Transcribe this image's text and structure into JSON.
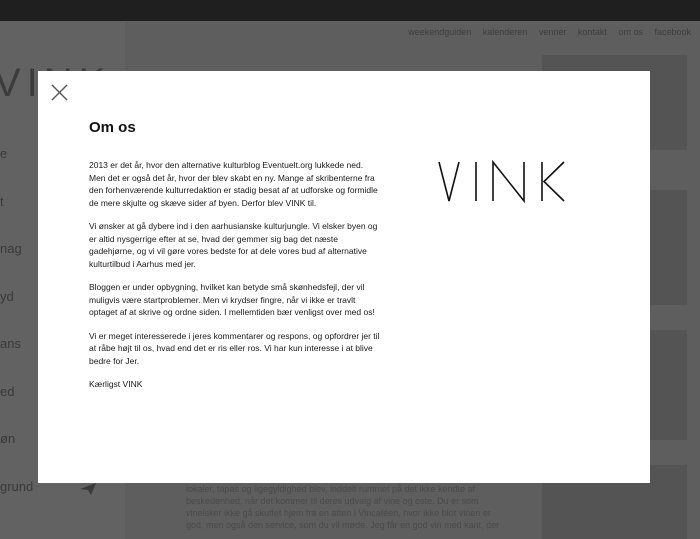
{
  "sidebar": {
    "logo_text": "VINK",
    "items": [
      {
        "label": "e"
      },
      {
        "label": "t"
      },
      {
        "label": "nag"
      },
      {
        "label": "yd"
      },
      {
        "label": "ans"
      },
      {
        "label": "ed"
      },
      {
        "label": "øn"
      },
      {
        "label": "grund"
      }
    ]
  },
  "nav": {
    "links": [
      "weekendguiden",
      "kalenderen",
      "venner",
      "kontakt",
      "om os",
      "facebook"
    ]
  },
  "right_col": {
    "captions": [
      "",
      "",
      "",
      ""
    ]
  },
  "background_article": {
    "lines": [
      "lokaler, tapas og ligegyldighed blev, inddelt rummet på det ikke kendte af",
      "beskedenhed, når det kommer til deres udvalg af vine og oste. Du er som",
      "vinelsker ikke gå skuffet hjem fra en aften i Vincaféen, hvor ikke blot vinen er",
      "god, men også den service, som du vil møde. Jeg får en god vin med kant, der"
    ]
  },
  "modal": {
    "title": "Om os",
    "paragraphs": [
      "2013 er det år, hvor den alternative kulturblog Eventuelt.org lukkede ned. Men det er også det år, hvor der blev skabt en ny. Mange af skribenterne fra den forhenværende kulturredaktion er stadig besat af at udforske og formidle de mere skjulte og skæve sider af byen. Derfor blev VINK til.",
      "Vi ønsker at gå dybere ind i den aarhusianske kulturjungle. Vi elsker byen og er altid nysgerrige efter at se, hvad der gemmer sig bag det næste gadehjørne, og vi vil gøre vores bedste for at dele vores bud af alternative kulturtilbud i Aarhus med jer.",
      "Bloggen er under opbygning, hvilket kan betyde små skønhedsfejl, der vil muligvis være startproblemer. Men vi krydser fingre, når vi ikke er travlt optaget af at skrive og ordne siden. I mellemtiden bær venligst over med os!",
      "Vi er meget interesserede i jeres kommentarer og respons, og opfordrer jer til at råbe højt til os, hvad end det er ris eller ros. Vi har kun interesse i at blive bedre for Jer.",
      "Kærligst VINK"
    ],
    "logo_text": "VINK",
    "close_icon": "close-icon"
  }
}
